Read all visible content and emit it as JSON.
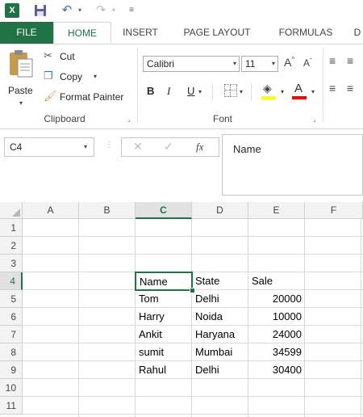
{
  "window": {
    "app_logo": "X"
  },
  "qat": {
    "save_icon": "save-icon",
    "undo_icon": "undo-icon",
    "redo_icon": "redo-icon"
  },
  "tabs": [
    {
      "label": "FILE"
    },
    {
      "label": "HOME"
    },
    {
      "label": "INSERT"
    },
    {
      "label": "PAGE LAYOUT"
    },
    {
      "label": "FORMULAS"
    },
    {
      "label": "D"
    }
  ],
  "ribbon": {
    "clipboard": {
      "paste_label": "Paste",
      "cut_label": "Cut",
      "copy_label": "Copy",
      "format_painter_label": "Format Painter",
      "group_label": "Clipboard"
    },
    "font": {
      "font_name": "Calibri",
      "font_size": "11",
      "bold": "B",
      "italic": "I",
      "underline": "U",
      "font_color_letter": "A",
      "grow_letter": "A",
      "shrink_letter": "A",
      "group_label": "Font",
      "fill_color": "#ffff00",
      "font_color": "#ff0000"
    }
  },
  "formula_bar": {
    "name_box": "C4",
    "fx_label": "fx",
    "content": "Name"
  },
  "grid": {
    "columns": [
      "A",
      "B",
      "C",
      "D",
      "E",
      "F"
    ],
    "active_column": "C",
    "rows": [
      "1",
      "2",
      "3",
      "4",
      "5",
      "6",
      "7",
      "8",
      "9",
      "10",
      "11"
    ],
    "active_row": "4",
    "cells": {
      "C4": "Name",
      "D4": "State",
      "E4": "Sale",
      "C5": "Tom",
      "D5": "Delhi",
      "E5": "20000",
      "C6": "Harry",
      "D6": "Noida",
      "E6": "10000",
      "C7": "Ankit",
      "D7": "Haryana",
      "E7": "24000",
      "C8": "sumit",
      "D8": "Mumbai",
      "E8": "34599",
      "C9": "Rahul",
      "D9": "Delhi",
      "E9": "30400"
    }
  },
  "colors": {
    "accent": "#217346"
  }
}
